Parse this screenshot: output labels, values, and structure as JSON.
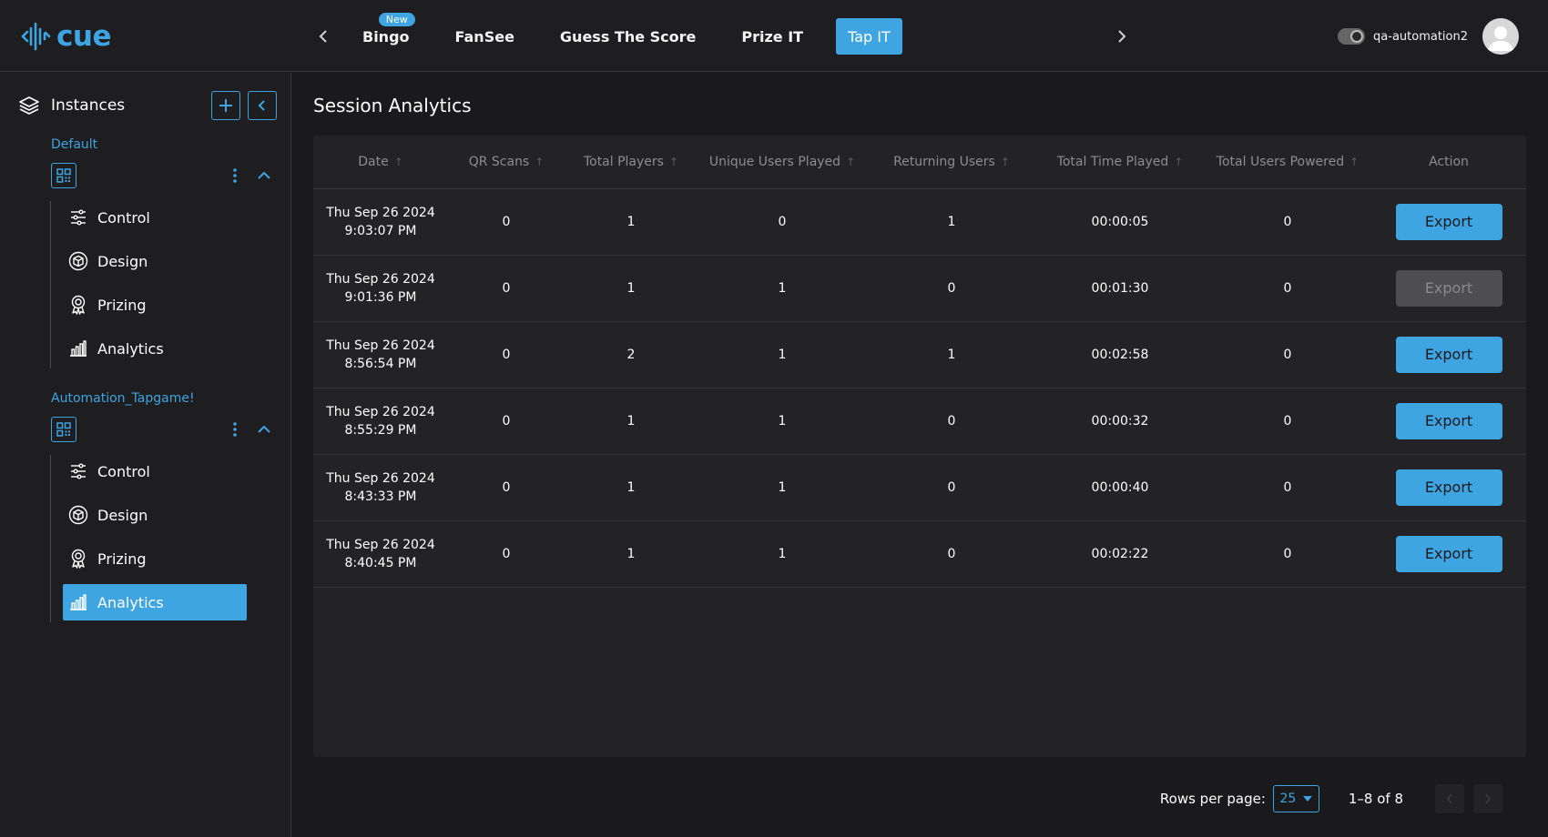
{
  "brand": {
    "name": "cue",
    "accent": "#3ea4e2"
  },
  "header": {
    "tabs": [
      {
        "label": "Bingo",
        "badge": "New"
      },
      {
        "label": "FanSee"
      },
      {
        "label": "Guess The Score"
      },
      {
        "label": "Prize IT"
      },
      {
        "label": "Tap IT",
        "active": true
      }
    ],
    "username": "qa-automation2",
    "icons": [
      "chevron-left-icon",
      "chevron-right-icon",
      "toggle-icon",
      "user-avatar-icon"
    ]
  },
  "sidebar": {
    "title": "Instances",
    "groups": [
      {
        "name": "Default",
        "items": [
          {
            "label": "Control",
            "icon": "sliders-icon"
          },
          {
            "label": "Design",
            "icon": "cube-icon"
          },
          {
            "label": "Prizing",
            "icon": "award-icon"
          },
          {
            "label": "Analytics",
            "icon": "bar-chart-icon"
          }
        ]
      },
      {
        "name": "Automation_Tapgame!",
        "items": [
          {
            "label": "Control",
            "icon": "sliders-icon"
          },
          {
            "label": "Design",
            "icon": "cube-icon"
          },
          {
            "label": "Prizing",
            "icon": "award-icon"
          },
          {
            "label": "Analytics",
            "icon": "bar-chart-icon",
            "active": true
          }
        ]
      }
    ]
  },
  "main": {
    "title": "Session Analytics",
    "columns": [
      "Date",
      "QR Scans",
      "Total Players",
      "Unique Users Played",
      "Returning Users",
      "Total Time Played",
      "Total Users Powered",
      "Action"
    ],
    "rows": [
      {
        "date": "Thu Sep 26 2024",
        "time": "9:03:07 PM",
        "qr": "0",
        "players": "1",
        "unique": "0",
        "returning": "1",
        "time_played": "00:00:05",
        "powered": "0",
        "action": "Export",
        "disabled": false
      },
      {
        "date": "Thu Sep 26 2024",
        "time": "9:01:36 PM",
        "qr": "0",
        "players": "1",
        "unique": "1",
        "returning": "0",
        "time_played": "00:01:30",
        "powered": "0",
        "action": "Export",
        "disabled": true
      },
      {
        "date": "Thu Sep 26 2024",
        "time": "8:56:54 PM",
        "qr": "0",
        "players": "2",
        "unique": "1",
        "returning": "1",
        "time_played": "00:02:58",
        "powered": "0",
        "action": "Export",
        "disabled": false
      },
      {
        "date": "Thu Sep 26 2024",
        "time": "8:55:29 PM",
        "qr": "0",
        "players": "1",
        "unique": "1",
        "returning": "0",
        "time_played": "00:00:32",
        "powered": "0",
        "action": "Export",
        "disabled": false
      },
      {
        "date": "Thu Sep 26 2024",
        "time": "8:43:33 PM",
        "qr": "0",
        "players": "1",
        "unique": "1",
        "returning": "0",
        "time_played": "00:00:40",
        "powered": "0",
        "action": "Export",
        "disabled": false
      },
      {
        "date": "Thu Sep 26 2024",
        "time": "8:40:45 PM",
        "qr": "0",
        "players": "1",
        "unique": "1",
        "returning": "0",
        "time_played": "00:02:22",
        "powered": "0",
        "action": "Export",
        "disabled": false
      }
    ]
  },
  "pagination": {
    "rows_per_page_label": "Rows per page:",
    "rows_per_page": "25",
    "range": "1–8 of 8"
  }
}
